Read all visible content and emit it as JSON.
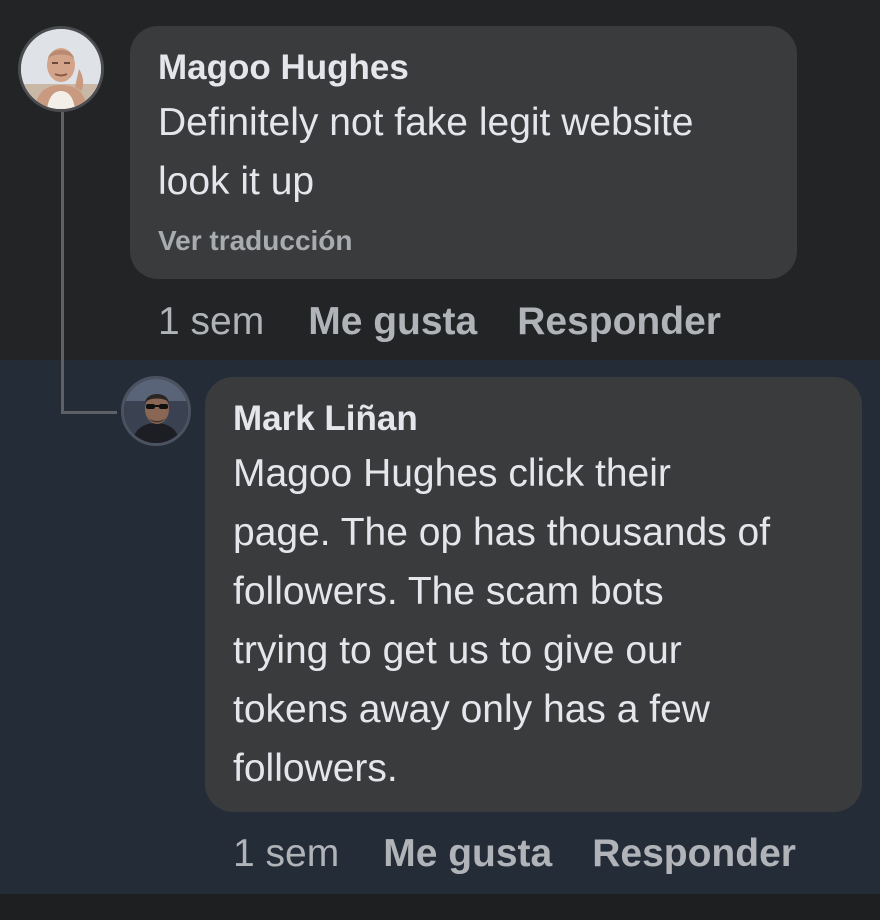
{
  "comments": [
    {
      "author": "Magoo Hughes",
      "avatar_icon": "user-avatar-photo",
      "lines": [
        "Definitely not fake legit website",
        "look it up"
      ],
      "translate_label": "Ver traducción",
      "timestamp": "1 sem",
      "like_label": "Me gusta",
      "reply_label": "Responder"
    },
    {
      "author": "Mark Liñan",
      "avatar_icon": "user-avatar-photo",
      "lines": [
        "Magoo Hughes click their",
        "page. The op has thousands of",
        "followers. The scam bots",
        "trying to get us to give our",
        "tokens away only has a few",
        "followers."
      ],
      "timestamp": "1 sem",
      "like_label": "Me gusta",
      "reply_label": "Responder"
    }
  ],
  "colors": {
    "background": "#232425",
    "reply_highlight": "#242c38",
    "bubble": "#3a3b3c",
    "primary_text": "#e4e6eb",
    "secondary_text": "#b0b3b8"
  }
}
